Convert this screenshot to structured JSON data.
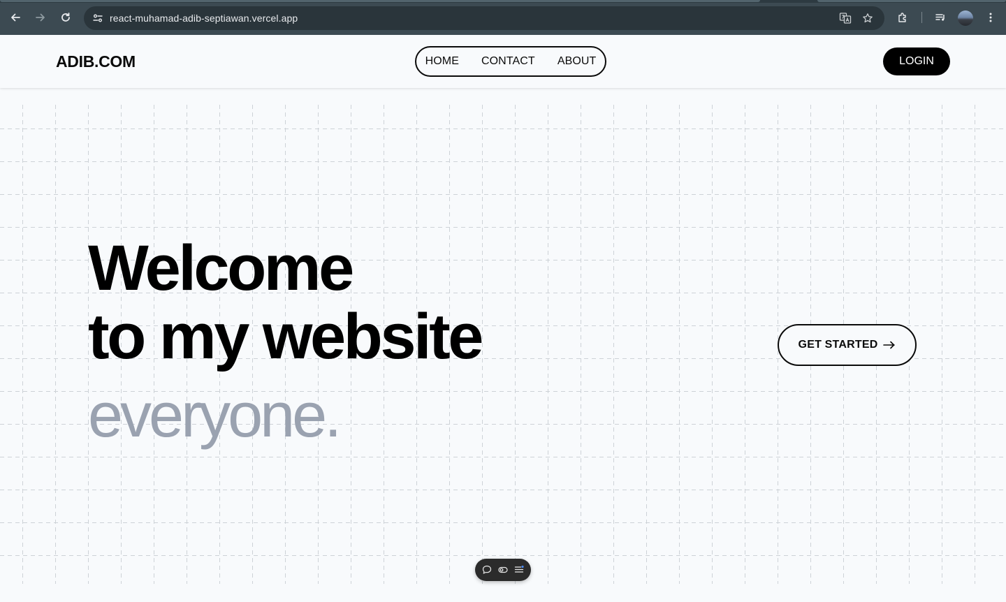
{
  "browser": {
    "url": "react-muhamad-adib-septiawan.vercel.app",
    "icons": [
      "back-arrow-icon",
      "forward-arrow-icon",
      "reload-icon",
      "site-settings-icon",
      "translate-icon",
      "star-icon",
      "extensions-icon",
      "media-queue-icon",
      "profile-avatar",
      "more-menu-icon"
    ]
  },
  "header": {
    "logo": "ADIB.COM",
    "nav": [
      {
        "label": "HOME"
      },
      {
        "label": "CONTACT"
      },
      {
        "label": "ABOUT"
      }
    ],
    "login_label": "LOGIN"
  },
  "hero": {
    "line1": "Welcome",
    "line2": "to my website",
    "line3": "everyone.",
    "cta_label": "GET STARTED"
  },
  "floating_toolbar": {
    "icons": [
      "comment-icon",
      "toggle-view-icon",
      "menu-list-icon"
    ]
  },
  "colors": {
    "chrome_bg": "#3c4a52",
    "page_bg": "#f8fafc",
    "text_primary": "#000000",
    "text_muted": "#9aa2b0",
    "grid_dash": "#c9ced4"
  }
}
